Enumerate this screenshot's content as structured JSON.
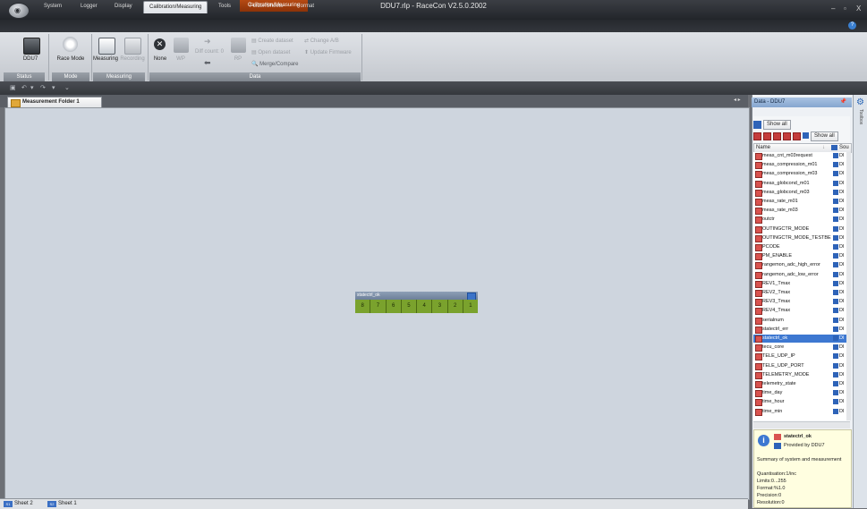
{
  "window": {
    "title": "DDU7.rlp - RaceCon V2.5.0.2002",
    "context_tab": "Calibration/Measuring",
    "controls": [
      "–",
      "▫",
      "X"
    ]
  },
  "menu_tabs": [
    "System",
    "Logger",
    "Display",
    "Calibration/Measuring",
    "Tools",
    "Folder/Sheets",
    "Format"
  ],
  "ribbon": {
    "groups": {
      "status": "Status",
      "mode": "Mode",
      "measuring": "Measuring",
      "data": "Data"
    },
    "buttons": {
      "ddu7": "DDU7",
      "race_mode": "Race Mode",
      "measuring": "Measuring",
      "recording": "Recording",
      "none": "None",
      "wp": "WP",
      "diff_count": "Diff count: 0",
      "rp": "RP",
      "create_dataset": "Create dataset",
      "change_ab": "Change A/B",
      "open_dataset": "Open dataset",
      "update_firmware": "Update Firmware",
      "merge_compare": "Merge/Compare"
    }
  },
  "document": {
    "folder_tab": "Measurement Folder 1",
    "widget": {
      "title": "statectrl_ok",
      "bits": [
        "8",
        "7",
        "6",
        "5",
        "4",
        "3",
        "2",
        "1"
      ]
    },
    "sheets": [
      {
        "icon": "S1",
        "label": "Sheet 2"
      },
      {
        "icon": "S2",
        "label": "Sheet 1"
      }
    ]
  },
  "data_panel": {
    "title": "Data - DDU7",
    "show_all_top": "Show all",
    "show_all_right": "Show all",
    "toolbox_label": "Toolbox",
    "columns": {
      "name": "Name",
      "source": "Sou"
    },
    "rows": [
      {
        "name": "meas_cnt_m03request",
        "src": "DI"
      },
      {
        "name": "meas_compression_m01",
        "src": "DI"
      },
      {
        "name": "meas_compression_m03",
        "src": "DI"
      },
      {
        "name": "meas_globcond_m01",
        "src": "DI"
      },
      {
        "name": "meas_globcond_m03",
        "src": "DI"
      },
      {
        "name": "meas_rate_m01",
        "src": "DI"
      },
      {
        "name": "meas_rate_m03",
        "src": "DI"
      },
      {
        "name": "outctr",
        "src": "DI"
      },
      {
        "name": "OUTINGCTR_MODE",
        "src": "DI"
      },
      {
        "name": "OUTINGCTR_MODE_TESTBE",
        "src": "DI"
      },
      {
        "name": "PCODE",
        "src": "DI"
      },
      {
        "name": "PM_ENABLE",
        "src": "DI"
      },
      {
        "name": "rangemon_adc_high_error",
        "src": "DI"
      },
      {
        "name": "rangemon_adc_low_error",
        "src": "DI"
      },
      {
        "name": "REV1_Tmax",
        "src": "DI"
      },
      {
        "name": "REV2_Tmax",
        "src": "DI"
      },
      {
        "name": "REV3_Tmax",
        "src": "DI"
      },
      {
        "name": "REV4_Tmax",
        "src": "DI"
      },
      {
        "name": "serialnum",
        "src": "DI"
      },
      {
        "name": "statectrl_err",
        "src": "DI"
      },
      {
        "name": "statectrl_ok",
        "src": "DI",
        "selected": true
      },
      {
        "name": "tecu_core",
        "src": "DI"
      },
      {
        "name": "TELE_UDP_IP",
        "src": "DI"
      },
      {
        "name": "TELE_UDP_PORT",
        "src": "DI"
      },
      {
        "name": "TELEMETRY_MODE",
        "src": "DI"
      },
      {
        "name": "telemetry_state",
        "src": "DI"
      },
      {
        "name": "time_day",
        "src": "DI"
      },
      {
        "name": "time_hour",
        "src": "DI"
      },
      {
        "name": "time_min",
        "src": "DI"
      }
    ],
    "info": {
      "name": "statectrl_ok",
      "provider": "Provided by DDU7",
      "summary": "Summary of system and measurement",
      "quantisation": "Quantisation:1/inc",
      "limits": "Limits:0...255",
      "format": "Format:%1.0",
      "precision": "Precision:0",
      "resolution": "Resolution:0"
    }
  }
}
